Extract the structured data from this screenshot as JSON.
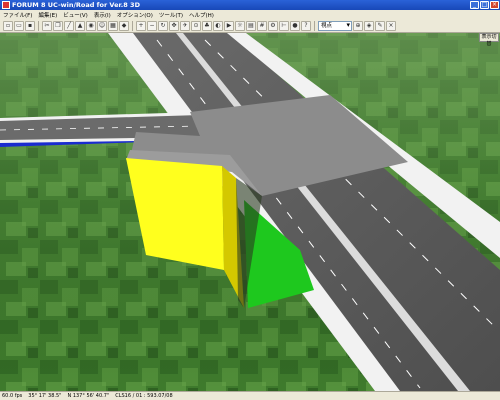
{
  "window": {
    "title": "FORUM 8  UC-win/Road for Ver.8 3D",
    "minimize": "_",
    "maximize": "□",
    "close": "×"
  },
  "menu": [
    "ファイル(F)",
    "編集(E)",
    "ビュー(V)",
    "表示(I)",
    "オプション(O)",
    "ツール(T)",
    "ヘルプ(H)"
  ],
  "toolbar": {
    "view_select": "視点"
  },
  "panel": {
    "label": "表示切替"
  },
  "status": {
    "fps": "60.0 fps",
    "lat": "35° 17' 38.5\"",
    "lon": "N 137° 56' 40.7\"",
    "scale": "CLS16 / 01 : 593.07/08"
  }
}
